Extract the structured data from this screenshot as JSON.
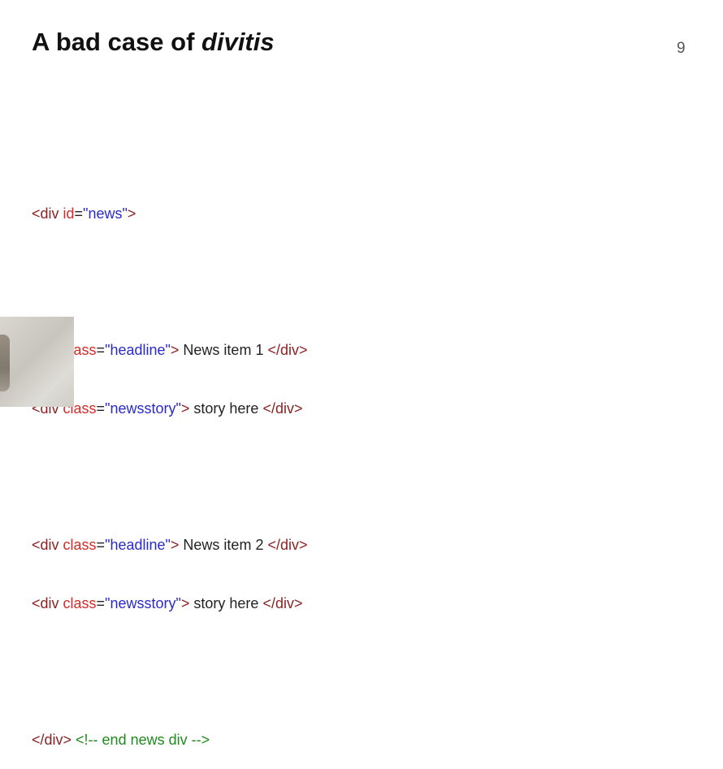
{
  "slide": {
    "title_plain": "A bad case of ",
    "title_italic": "divitis",
    "number": "9"
  },
  "code": {
    "outer_open_tag_start": "<div ",
    "outer_attr": "id",
    "eq": "=",
    "outer_val": "\"news\"",
    "tag_end": ">",
    "div_open": "<div ",
    "attr_class": "class",
    "val_headline": "\"headline\"",
    "val_newsstory": "\"newsstory\"",
    "item1_text": " News item 1 ",
    "item2_text": " News item 2 ",
    "story_text": " story here ",
    "div_close": "</div>",
    "outer_close": "</div>",
    "comment": " <!-- end news div -->"
  }
}
